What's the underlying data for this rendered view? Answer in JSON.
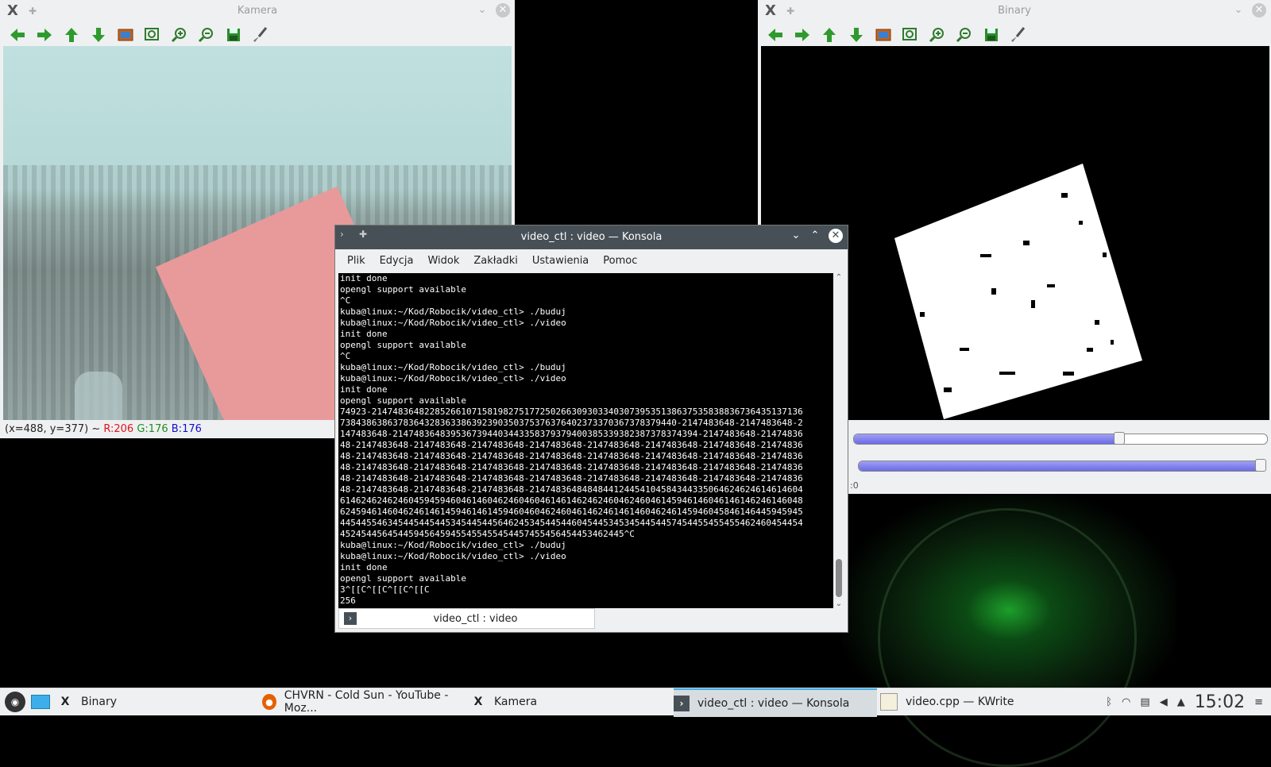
{
  "kamera_window": {
    "title": "Kamera",
    "status_coords": "(x=488, y=377) ~",
    "status_r": "R:206",
    "status_g": "G:176",
    "status_b": "B:176",
    "colors": {
      "r": "#e0141b",
      "g": "#1e8c1e",
      "b": "#1010d0"
    }
  },
  "binary_window": {
    "title": "Binary",
    "slider1_value": 0.63,
    "slider2_value": 1.0,
    "partial_label": ":0"
  },
  "toolbar_icons": [
    "back-arrow-icon",
    "forward-arrow-icon",
    "up-arrow-icon",
    "down-arrow-icon",
    "image-icon",
    "zoom-fit-icon",
    "zoom-in-icon",
    "zoom-out-icon",
    "save-icon",
    "brush-icon"
  ],
  "konsole": {
    "title": "video_ctl : video — Konsola",
    "menu": [
      "Plik",
      "Edycja",
      "Widok",
      "Zakładki",
      "Ustawienia",
      "Pomoc"
    ],
    "terminal_lines": [
      "init done",
      "opengl support available",
      "^C",
      "kuba@linux:~/Kod/Robocik/video_ctl> ./buduj",
      "kuba@linux:~/Kod/Robocik/video_ctl> ./video",
      "init done",
      "opengl support available",
      "^C",
      "kuba@linux:~/Kod/Robocik/video_ctl> ./buduj",
      "kuba@linux:~/Kod/Robocik/video_ctl> ./video",
      "init done",
      "opengl support available",
      "74923-2147483648228526610715819827517725026630930334030739535138637535838836736435137136",
      "7384386386378364328363386392390350375376376402373370367378379440-2147483648-2147483648-2",
      "147483648-2147483648395367394403443358379379400385339382387378374394-2147483648-21474836",
      "48-2147483648-2147483648-2147483648-2147483648-2147483648-2147483648-2147483648-21474836",
      "48-2147483648-2147483648-2147483648-2147483648-2147483648-2147483648-2147483648-21474836",
      "48-2147483648-2147483648-2147483648-2147483648-2147483648-2147483648-2147483648-21474836",
      "48-2147483648-2147483648-2147483648-2147483648-2147483648-2147483648-2147483648-21474836",
      "48-2147483648-2147483648-2147483648-2147483648484844124454104584344335064624624614614604",
      "6146246246246045945946046146046246046046146146246246046246046145946146046146146246146048",
      "6245946146046246146145946146145946046046246046146246146146046246145946045846146445945945",
      "4454455463454454454453454454456462453454454460454453453454454457454455455455462460454454",
      "452454456454459456459455455455454457455456454453462445^C",
      "kuba@linux:~/Kod/Robocik/video_ctl> ./buduj",
      "kuba@linux:~/Kod/Robocik/video_ctl> ./video",
      "init done",
      "opengl support available",
      "3^[[C^[[C^[[C^[[C",
      "256"
    ],
    "tab_label": "video_ctl : video"
  },
  "taskbar": {
    "tasks": [
      {
        "label": "Binary",
        "icon": "x-app-icon"
      },
      {
        "label": "CHVRN - Cold Sun - YouTube - Moz...",
        "icon": "firefox-icon"
      },
      {
        "label": "Kamera",
        "icon": "x-app-icon"
      },
      {
        "label": "video_ctl : video — Konsola",
        "icon": "terminal-icon"
      },
      {
        "label": "video.cpp  — KWrite",
        "icon": "kwrite-icon"
      }
    ],
    "clock": "15:02"
  }
}
